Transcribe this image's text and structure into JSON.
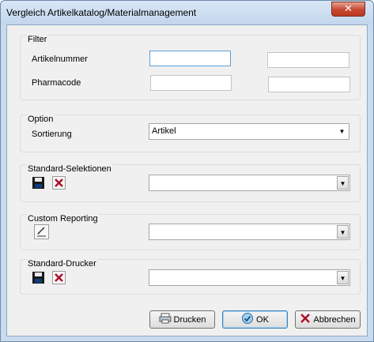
{
  "window": {
    "title": "Vergleich Artikelkatalog/Materialmanagement",
    "close_glyph": "✕"
  },
  "filter": {
    "title": "Filter",
    "artikelnummer_label": "Artikelnummer",
    "pharmacode_label": "Pharmacode",
    "artikelnummer_from": "",
    "artikelnummer_to": "",
    "pharmacode_from": "",
    "pharmacode_to": ""
  },
  "option": {
    "title": "Option",
    "sortierung_label": "Sortierung",
    "sortierung_value": "Artikel"
  },
  "standard_selektionen": {
    "title": "Standard-Selektionen",
    "value": "",
    "icons": [
      "floppy-disk-icon",
      "delete-x-icon"
    ]
  },
  "custom_reporting": {
    "title": "Custom Reporting",
    "value": "",
    "icons": [
      "edit-report-icon"
    ]
  },
  "standard_drucker": {
    "title": "Standard-Drucker",
    "value": "",
    "icons": [
      "floppy-disk-icon",
      "delete-x-icon"
    ]
  },
  "buttons": {
    "print_label": "Drucken",
    "ok_label": "OK",
    "cancel_label": "Abbrechen"
  },
  "colors": {
    "window_frame": "#c9dbee",
    "client_bg": "#f0f0f0",
    "close_red": "#c7472f",
    "delete_red": "#b0102a",
    "focus_blue": "#5d9fd6"
  }
}
